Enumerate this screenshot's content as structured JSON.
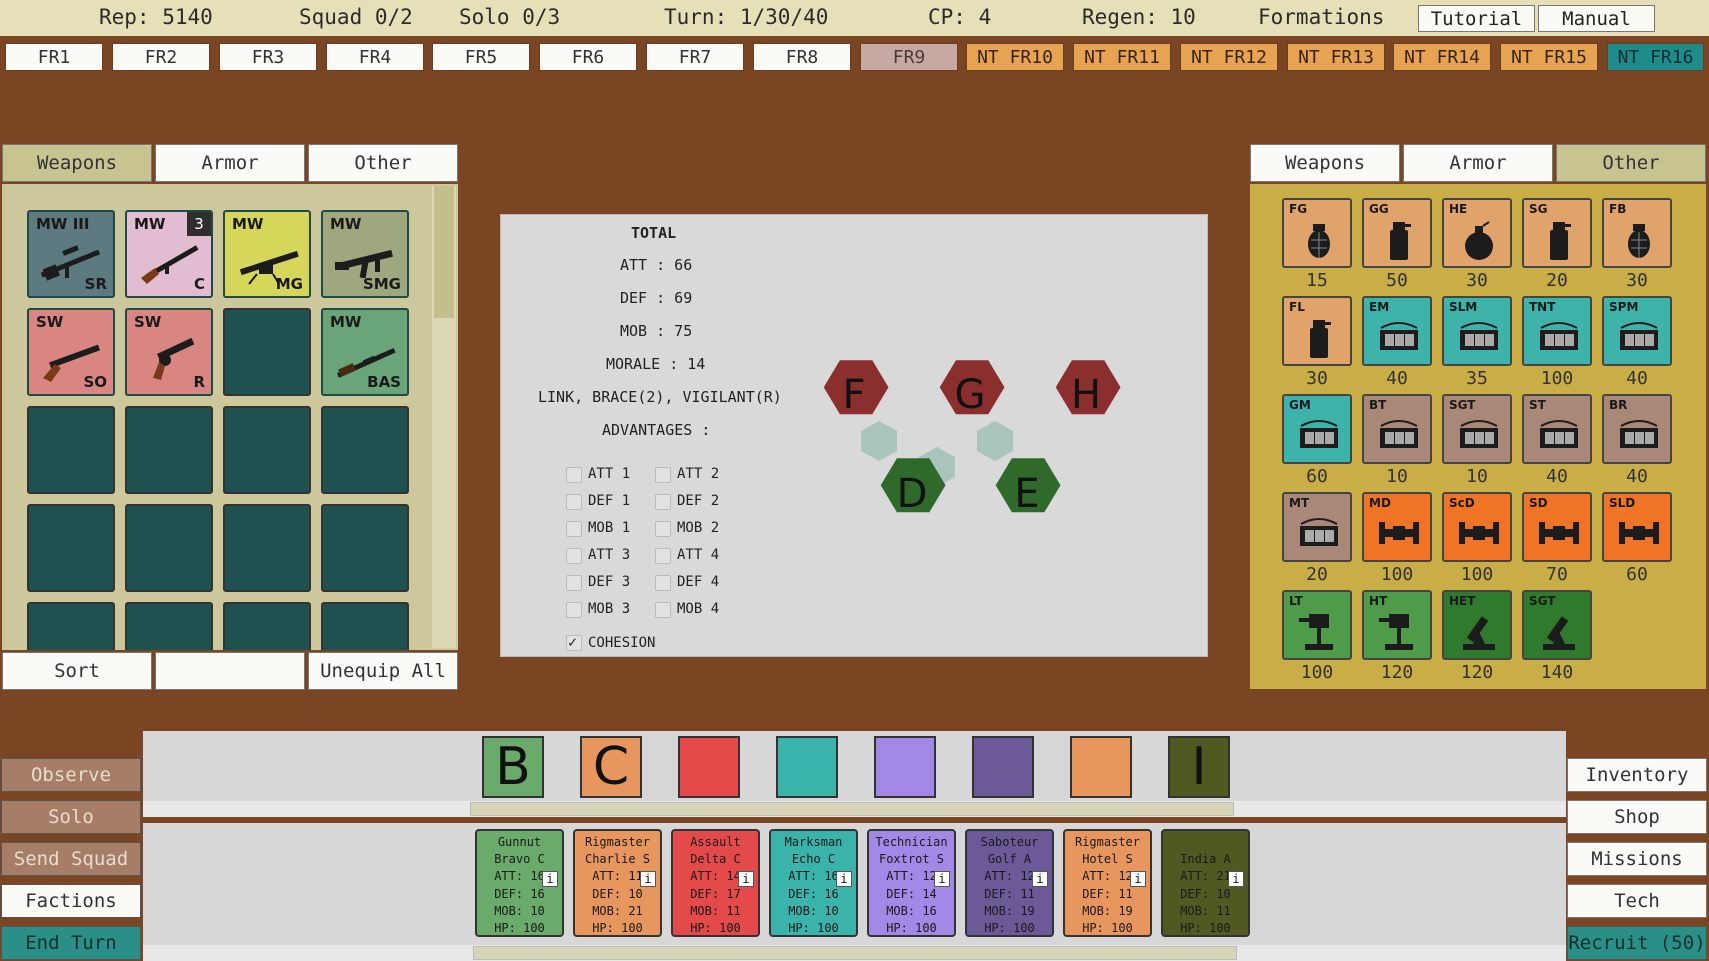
{
  "stats": {
    "rep": "Rep: 5140",
    "squad": "Squad 0/2",
    "solo": "Solo 0/3",
    "turn": "Turn: 1/30/40",
    "cp": "CP: 4",
    "regen": "Regen: 10",
    "formations": "Formations"
  },
  "top_buttons": {
    "tutorial": "Tutorial",
    "manual": "Manual"
  },
  "formations": [
    "FR1",
    "FR2",
    "FR3",
    "FR4",
    "FR5",
    "FR6",
    "FR7",
    "FR8",
    "FR9",
    "NT FR10",
    "NT FR11",
    "NT FR12",
    "NT FR13",
    "NT FR14",
    "NT FR15",
    "NT FR16"
  ],
  "left_tabs": {
    "weapons": "Weapons",
    "armor": "Armor",
    "other": "Other"
  },
  "right_tabs": {
    "weapons": "Weapons",
    "armor": "Armor",
    "other": "Other"
  },
  "weapons": [
    {
      "title": "MW III",
      "sub": "SR",
      "color": "#5d7a80"
    },
    {
      "title": "MW",
      "sub": "C",
      "count": "3",
      "color": "#e2bcd1"
    },
    {
      "title": "MW",
      "sub": "MG",
      "color": "#d6d65a"
    },
    {
      "title": "MW",
      "sub": "SMG",
      "color": "#9fa77f"
    },
    {
      "title": "SW",
      "sub": "SO",
      "color": "#d98683"
    },
    {
      "title": "SW",
      "sub": "R",
      "color": "#d98683"
    },
    {
      "title": "MW",
      "sub": "BAS",
      "color": "#6aa57a"
    }
  ],
  "left_buttons": {
    "sort": "Sort",
    "blank": "",
    "unequip": "Unequip All"
  },
  "total": {
    "heading": "TOTAL",
    "att": "ATT : 66",
    "def": "DEF : 69",
    "mob": "MOB : 75",
    "morale": "MORALE : 14",
    "traits": "LINK, BRACE(2), VIGILANT(R)",
    "advantages": "ADVANTAGES :",
    "checks": [
      "ATT 1",
      "ATT 2",
      "DEF 1",
      "DEF 2",
      "MOB 1",
      "MOB 2",
      "ATT 3",
      "ATT 4",
      "DEF 3",
      "DEF 4",
      "MOB 3",
      "MOB 4"
    ],
    "cohesion": "COHESION"
  },
  "hexes": {
    "f": "F",
    "g": "G",
    "h": "H",
    "d": "D",
    "e": "E"
  },
  "other_items": [
    {
      "code": "FG",
      "count": "15",
      "color": "#e0a46b",
      "icon": "grenade-icon"
    },
    {
      "code": "GG",
      "count": "50",
      "color": "#e0a46b",
      "icon": "gas-grenade-icon"
    },
    {
      "code": "HE",
      "count": "30",
      "color": "#e0a46b",
      "icon": "bomb-icon"
    },
    {
      "code": "SG",
      "count": "20",
      "color": "#e0a46b",
      "icon": "smoke-grenade-icon"
    },
    {
      "code": "FB",
      "count": "30",
      "color": "#e0a46b",
      "icon": "frag-bomb-icon"
    },
    {
      "code": "FL",
      "count": "30",
      "color": "#e0a46b",
      "icon": "flare-icon"
    },
    {
      "code": "EM",
      "count": "40",
      "color": "#3db3aa",
      "icon": "explosive-pack-icon"
    },
    {
      "code": "SLM",
      "count": "35",
      "color": "#3db3aa",
      "icon": "explosive-pack-icon"
    },
    {
      "code": "TNT",
      "count": "100",
      "color": "#3db3aa",
      "icon": "explosive-pack-icon"
    },
    {
      "code": "SPM",
      "count": "40",
      "color": "#3db3aa",
      "icon": "explosive-pack-icon"
    },
    {
      "code": "GM",
      "count": "60",
      "color": "#3db3aa",
      "icon": "explosive-pack-icon"
    },
    {
      "code": "BT",
      "count": "10",
      "color": "#a98877",
      "icon": "explosive-pack-icon"
    },
    {
      "code": "SGT",
      "count": "10",
      "color": "#a98877",
      "icon": "explosive-pack-icon"
    },
    {
      "code": "ST",
      "count": "40",
      "color": "#a98877",
      "icon": "explosive-pack-icon"
    },
    {
      "code": "BR",
      "count": "40",
      "color": "#a98877",
      "icon": "explosive-pack-icon"
    },
    {
      "code": "MT",
      "count": "20",
      "color": "#a98877",
      "icon": "explosive-pack-icon"
    },
    {
      "code": "MD",
      "count": "100",
      "color": "#f07426",
      "icon": "dumbbell-mine-icon"
    },
    {
      "code": "ScD",
      "count": "100",
      "color": "#f07426",
      "icon": "dumbbell-mine-icon"
    },
    {
      "code": "SD",
      "count": "70",
      "color": "#f07426",
      "icon": "dumbbell-mine-icon"
    },
    {
      "code": "SLD",
      "count": "60",
      "color": "#f07426",
      "icon": "dumbbell-mine-icon"
    },
    {
      "code": "LT",
      "count": "100",
      "color": "#4e9c4a",
      "icon": "turret-icon"
    },
    {
      "code": "HT",
      "count": "120",
      "color": "#4e9c4a",
      "icon": "turret-icon"
    },
    {
      "code": "HET",
      "count": "120",
      "color": "#2f7a2d",
      "icon": "mortar-icon"
    },
    {
      "code": "SGT",
      "count": "140",
      "color": "#2f7a2d",
      "icon": "mortar-icon"
    }
  ],
  "squad_slots": [
    {
      "letter": "B",
      "color": "#6aaa6a"
    },
    {
      "letter": "C",
      "color": "#e7965e"
    },
    {
      "letter": "",
      "color": "#e54a4a"
    },
    {
      "letter": "",
      "color": "#3ab3aa"
    },
    {
      "letter": "",
      "color": "#a389e6"
    },
    {
      "letter": "",
      "color": "#6c5a98"
    },
    {
      "letter": "",
      "color": "#e7965e"
    },
    {
      "letter": "I",
      "color": "#525822"
    }
  ],
  "roster": [
    {
      "role": "Gunnut",
      "name": "Bravo C",
      "att": "ATT: 16",
      "def": "DEF: 16",
      "mob": "MOB: 10",
      "hp": "HP: 100",
      "color": "#6aaa6a"
    },
    {
      "role": "Rigmaster",
      "name": "Charlie S",
      "att": "ATT: 11",
      "def": "DEF: 10",
      "mob": "MOB: 21",
      "hp": "HP: 100",
      "color": "#e7965e"
    },
    {
      "role": "Assault",
      "name": "Delta C",
      "att": "ATT: 14",
      "def": "DEF: 17",
      "mob": "MOB: 11",
      "hp": "HP: 100",
      "color": "#e54a4a"
    },
    {
      "role": "Marksman",
      "name": "Echo C",
      "att": "ATT: 16",
      "def": "DEF: 16",
      "mob": "MOB: 10",
      "hp": "HP: 100",
      "color": "#3ab3aa"
    },
    {
      "role": "Technician",
      "name": "Foxtrot S",
      "att": "ATT: 12",
      "def": "DEF: 14",
      "mob": "MOB: 16",
      "hp": "HP: 100",
      "color": "#a389e6"
    },
    {
      "role": "Saboteur",
      "name": "Golf A",
      "att": "ATT: 12",
      "def": "DEF: 11",
      "mob": "MOB: 19",
      "hp": "HP: 100",
      "color": "#6c5a98"
    },
    {
      "role": "Rigmaster",
      "name": "Hotel S",
      "att": "ATT: 12",
      "def": "DEF: 11",
      "mob": "MOB: 19",
      "hp": "HP: 100",
      "color": "#e7965e"
    },
    {
      "role": "",
      "name": "India A",
      "att": "ATT: 21",
      "def": "DEF: 10",
      "mob": "MOB: 11",
      "hp": "HP: 100",
      "color": "#525822"
    }
  ],
  "info_glyph": "i",
  "left_actions": {
    "observe": "Observe",
    "solo": "Solo",
    "send_squad": "Send Squad",
    "factions": "Factions",
    "end_turn": "End Turn"
  },
  "right_actions": {
    "inventory": "Inventory",
    "shop": "Shop",
    "missions": "Missions",
    "tech": "Tech",
    "recruit": "Recruit (50)"
  }
}
